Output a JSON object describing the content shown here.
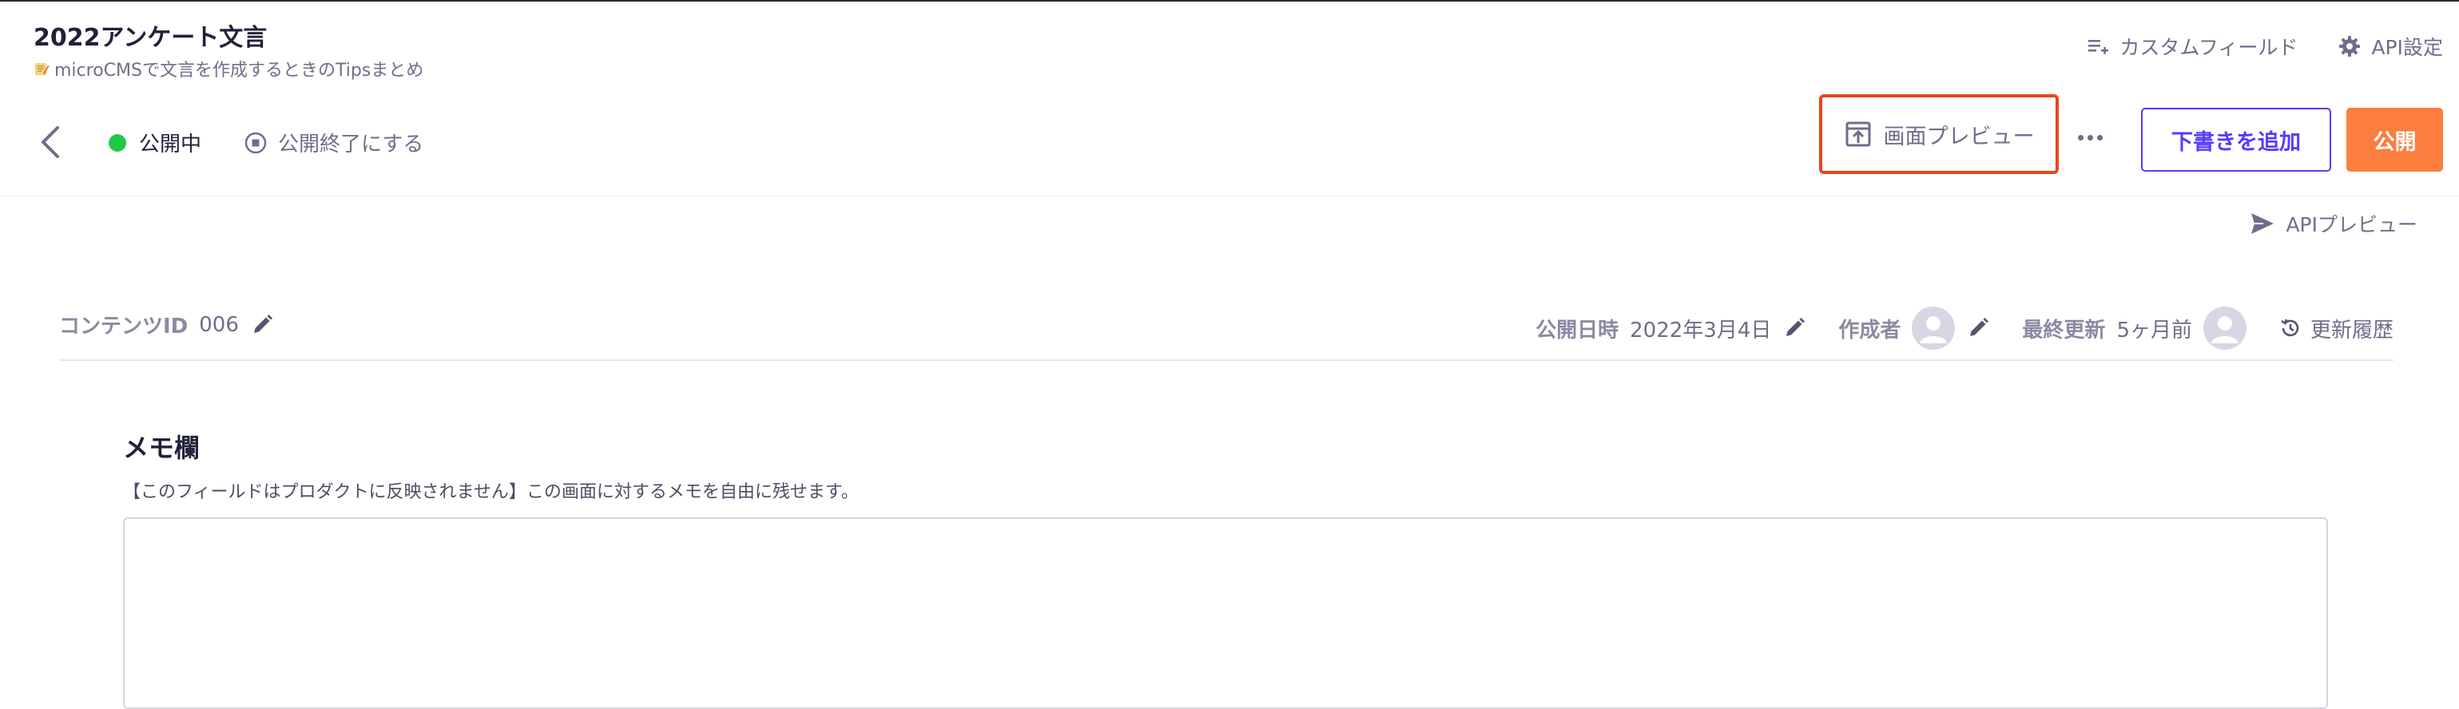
{
  "header": {
    "title": "2022アンケート文言",
    "subtitle": "microCMSで文言を作成するときのTipsまとめ",
    "custom_fields_label": "カスタムフィールド",
    "api_settings_label": "API設定"
  },
  "status_bar": {
    "status_label": "公開中",
    "status_color": "#20c943",
    "unpublish_label": "公開終了にする"
  },
  "actions": {
    "preview_label": "画面プレビュー",
    "draft_label": "下書きを追加",
    "publish_label": "公開",
    "accent_color": "#563bff",
    "publish_color": "#fb7e3e",
    "highlight_color": "#e8461f"
  },
  "api_preview_label": "APIプレビュー",
  "meta": {
    "content_id_label": "コンテンツID",
    "content_id_value": "006",
    "published_at_label": "公開日時",
    "published_at_value": "2022年3月4日",
    "author_label": "作成者",
    "updated_label": "最終更新",
    "updated_value": "5ヶ月前",
    "history_label": "更新履歴"
  },
  "memo": {
    "title": "メモ欄",
    "description": "【このフィールドはプロダクトに反映されません】この画面に対するメモを自由に残せます。",
    "value": ""
  }
}
